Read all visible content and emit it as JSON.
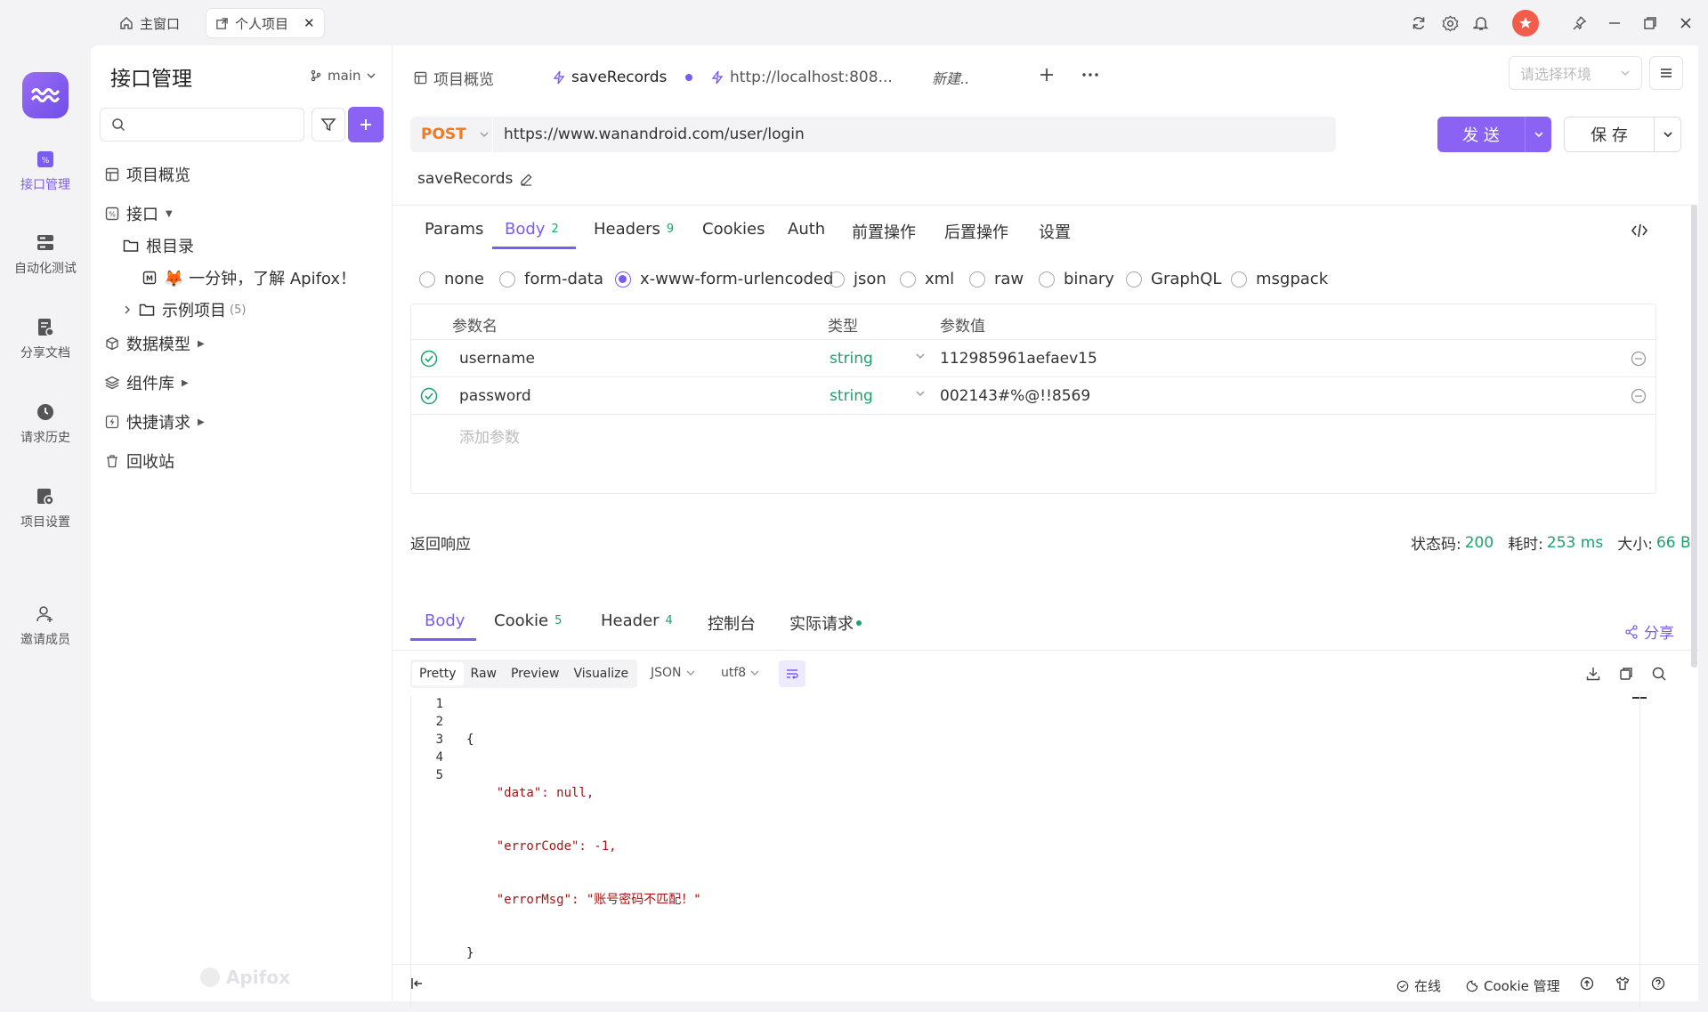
{
  "window": {
    "tabs": [
      {
        "label": "主窗口",
        "icon": "home-icon"
      },
      {
        "label": "个人项目",
        "icon": "external-window-icon"
      }
    ]
  },
  "rail": {
    "items": [
      {
        "label": "接口管理",
        "icon": "api-icon"
      },
      {
        "label": "自动化测试",
        "icon": "automation-icon"
      },
      {
        "label": "分享文档",
        "icon": "share-doc-icon"
      },
      {
        "label": "请求历史",
        "icon": "history-icon"
      },
      {
        "label": "项目设置",
        "icon": "project-settings-icon"
      },
      {
        "label": "邀请成员",
        "icon": "invite-member-icon"
      }
    ]
  },
  "sidebar": {
    "title": "接口管理",
    "branch": "main",
    "search_placeholder": "",
    "tree": {
      "overview": "项目概览",
      "api": "接口",
      "root": "根目录",
      "doc": "🦊 一分钟，了解 Apifox！",
      "examples": "示例项目",
      "examples_count": "(5)",
      "data_models": "数据模型",
      "components": "组件库",
      "quick_request": "快捷请求",
      "recycle": "回收站"
    },
    "watermark": "Apifox"
  },
  "main": {
    "tabs": [
      {
        "label": "项目概览"
      },
      {
        "label": "saveRecords"
      },
      {
        "label": "http://localhost:808..."
      },
      {
        "label": "新建.."
      }
    ],
    "env_placeholder": "请选择环境",
    "request": {
      "method": "POST",
      "url": "https://www.wanandroid.com/user/login",
      "send": "发 送",
      "save": "保 存",
      "name": "saveRecords"
    },
    "subtabs": [
      {
        "label": "Params",
        "count": ""
      },
      {
        "label": "Body",
        "count": "2"
      },
      {
        "label": "Headers",
        "count": "9"
      },
      {
        "label": "Cookies",
        "count": ""
      },
      {
        "label": "Auth",
        "count": ""
      },
      {
        "label": "前置操作",
        "count": ""
      },
      {
        "label": "后置操作",
        "count": ""
      },
      {
        "label": "设置",
        "count": ""
      }
    ],
    "body_types": [
      "none",
      "form-data",
      "x-www-form-urlencoded",
      "json",
      "xml",
      "raw",
      "binary",
      "GraphQL",
      "msgpack"
    ],
    "body_type_selected": "x-www-form-urlencoded",
    "params_table": {
      "headers": [
        "参数名",
        "类型",
        "参数值"
      ],
      "rows": [
        {
          "name": "username",
          "type": "string",
          "value": "112985961aefaev15"
        },
        {
          "name": "password",
          "type": "string",
          "value": "002143#%@!!8569"
        }
      ],
      "add_placeholder": "添加参数"
    },
    "response": {
      "title": "返回响应",
      "status_label": "状态码:",
      "status": "200",
      "time_label": "耗时:",
      "time": "253 ms",
      "size_label": "大小:",
      "size": "66 B",
      "tabs": [
        {
          "label": "Body",
          "count": ""
        },
        {
          "label": "Cookie",
          "count": "5"
        },
        {
          "label": "Header",
          "count": "4"
        },
        {
          "label": "控制台",
          "count": ""
        },
        {
          "label": "实际请求",
          "count": ""
        }
      ],
      "share": "分享",
      "view_modes": [
        "Pretty",
        "Raw",
        "Preview",
        "Visualize"
      ],
      "format": "JSON",
      "encoding": "utf8",
      "code_lines": [
        {
          "n": "1",
          "text": "{"
        },
        {
          "n": "2",
          "text": "    \"data\": null,"
        },
        {
          "n": "3",
          "text": "    \"errorCode\": -1,"
        },
        {
          "n": "4",
          "text": "    \"errorMsg\": \"账号密码不匹配！\""
        },
        {
          "n": "5",
          "text": "}"
        }
      ]
    }
  },
  "status_bar": {
    "online": "在线",
    "cookie": "Cookie 管理"
  },
  "colors": {
    "accent": "#7b5cf0",
    "post": "#f07a22",
    "green": "#1aa36a"
  }
}
